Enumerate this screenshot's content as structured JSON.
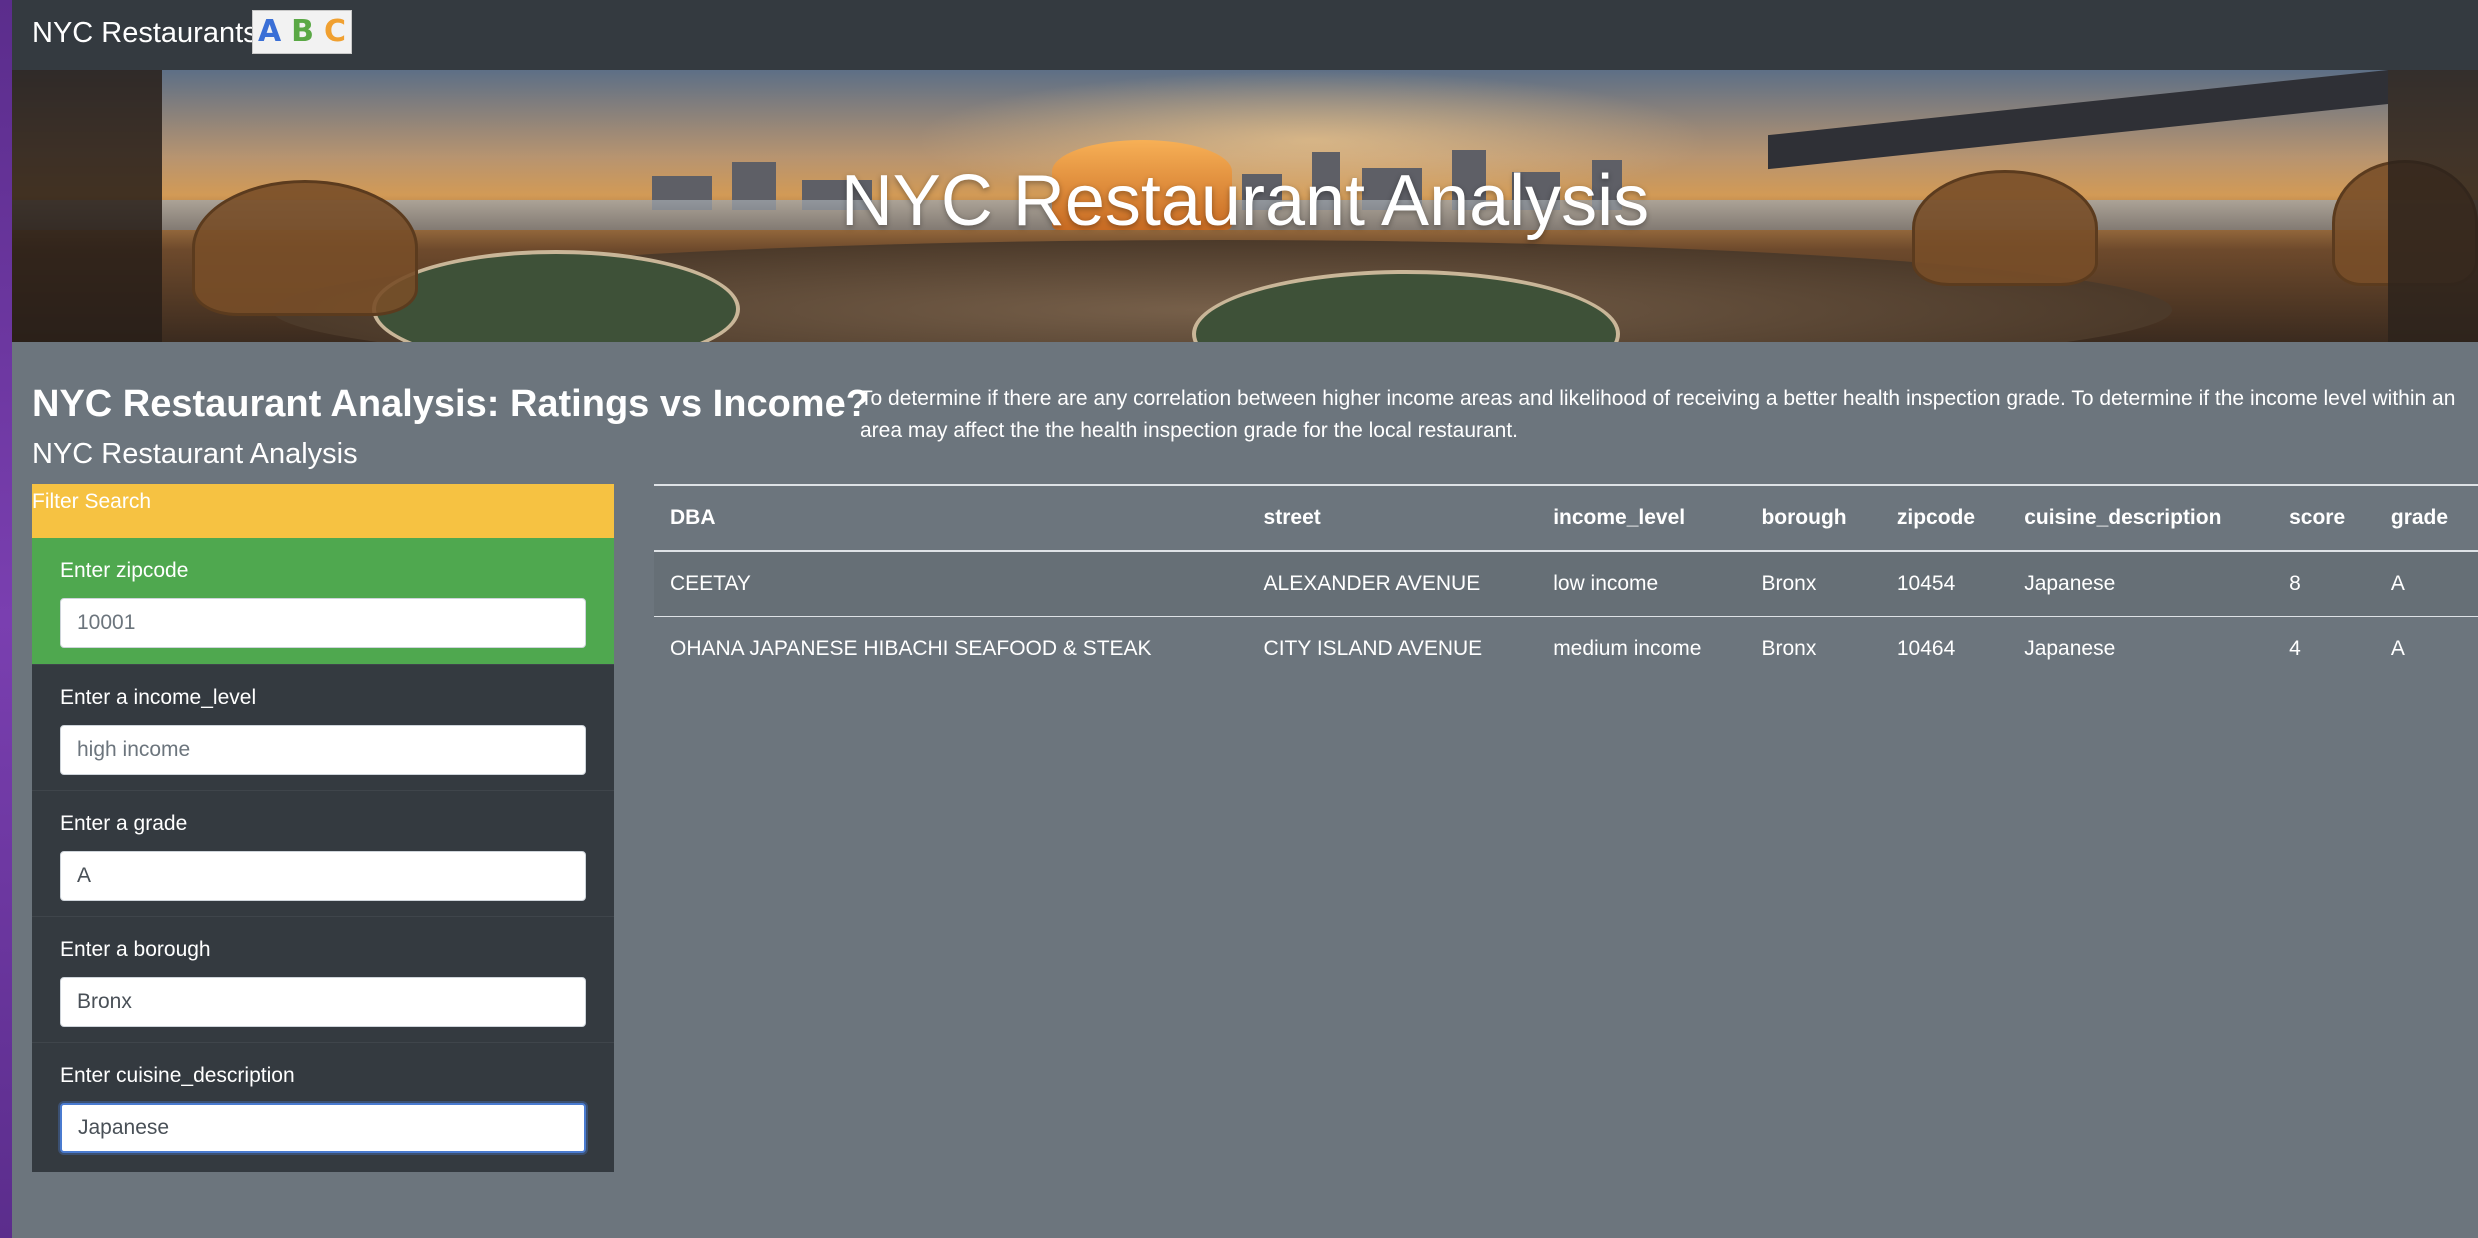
{
  "navbar": {
    "brand": "NYC Restaurants",
    "logo_letters": [
      "A",
      "B",
      "C"
    ]
  },
  "hero": {
    "title": "NYC Restaurant Analysis"
  },
  "intro": {
    "title": "NYC Restaurant Analysis: Ratings vs Income?",
    "subtitle": "NYC Restaurant Analysis",
    "description": "To determine if there are any correlation between higher income areas and likelihood of receiving a better health inspection grade. To determine if the income level within an area may affect the the health inspection grade for the local restaurant."
  },
  "filter": {
    "header": "Filter Search",
    "fields": [
      {
        "label": "Enter zipcode",
        "placeholder": "10001",
        "value": ""
      },
      {
        "label": "Enter a income_level",
        "placeholder": "high income",
        "value": ""
      },
      {
        "label": "Enter a grade",
        "placeholder": "",
        "value": "A"
      },
      {
        "label": "Enter a borough",
        "placeholder": "",
        "value": "Bronx"
      },
      {
        "label": "Enter cuisine_description",
        "placeholder": "",
        "value": "Japanese"
      }
    ]
  },
  "table": {
    "columns": [
      "DBA",
      "street",
      "income_level",
      "borough",
      "zipcode",
      "cuisine_description",
      "score",
      "grade"
    ],
    "rows": [
      [
        "CEETAY",
        "ALEXANDER AVENUE",
        "low income",
        "Bronx",
        "10454",
        "Japanese",
        "8",
        "A"
      ],
      [
        "OHANA JAPANESE HIBACHI SEAFOOD & STEAK",
        "CITY ISLAND AVENUE",
        "medium income",
        "Bronx",
        "10464",
        "Japanese",
        "4",
        "A"
      ]
    ]
  },
  "colors": {
    "body_bg": "#6c757d",
    "navbar_bg": "#343a40",
    "filter_header": "#f6c242",
    "zip_field_bg": "#4fa84f",
    "panel_bg": "#343a40"
  }
}
